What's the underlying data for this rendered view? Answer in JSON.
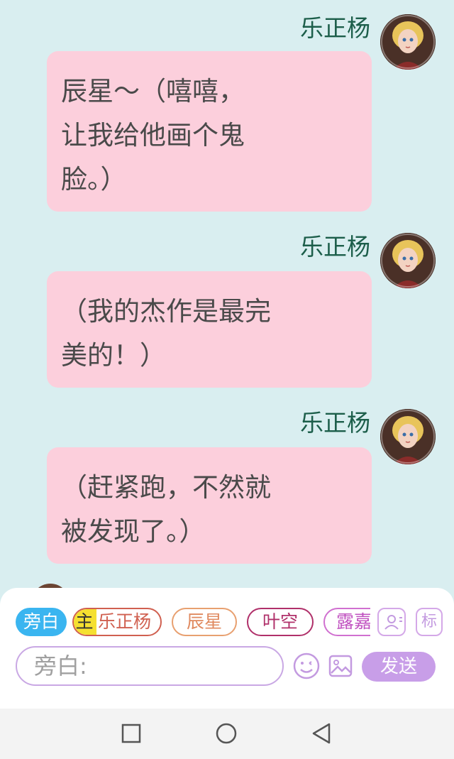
{
  "messages": [
    {
      "sender": "乐正杨",
      "text": "辰星～（嘻嘻，\n让我给他画个鬼\n脸。）"
    },
    {
      "sender": "乐正杨",
      "text": "（我的杰作是最完\n美的！）"
    },
    {
      "sender": "乐正杨",
      "text": "（赶紧跑，不然就\n被发现了。）"
    }
  ],
  "role_chips": {
    "narrator": "旁白",
    "main_marker": "主",
    "main_name": "乐正杨",
    "chenxing": "辰星",
    "yekong": "叶空",
    "lu": "露嘉"
  },
  "toolbar": {
    "mark_label": "标",
    "input_value": "旁白:",
    "send_label": "发送"
  },
  "icons": {
    "person": "person-card-icon",
    "emoji": "smiley-icon",
    "image": "image-icon",
    "back": "back-triangle-icon",
    "home": "home-circle-icon",
    "recent": "recent-square-icon"
  },
  "colors": {
    "chat_background": "#d9eef0",
    "bubble": "#fccfdc",
    "sender_name": "#1c5e4a",
    "accent_purple": "#c89ee8",
    "narrator_chip": "#3ab5f0"
  }
}
